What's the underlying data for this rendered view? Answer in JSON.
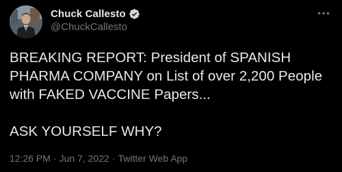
{
  "author": {
    "display_name": "Chuck Callesto",
    "handle": "@ChuckCallesto",
    "verified": true
  },
  "tweet": {
    "text": "BREAKING REPORT: President of SPANISH PHARMA COMPANY on List of over 2,200 People with FAKED VACCINE Papers...\n\nASK YOURSELF WHY?",
    "time": "12:26 PM",
    "separator": "·",
    "date": "Jun 7, 2022",
    "source": "Twitter Web App"
  },
  "icons": {
    "verified": "verified-badge-icon",
    "more": "more-options-icon"
  },
  "colors": {
    "background": "#000000",
    "primary_text": "#e7e9ea",
    "secondary_text": "#71767b",
    "verified_badge": "#d9d9d9"
  }
}
